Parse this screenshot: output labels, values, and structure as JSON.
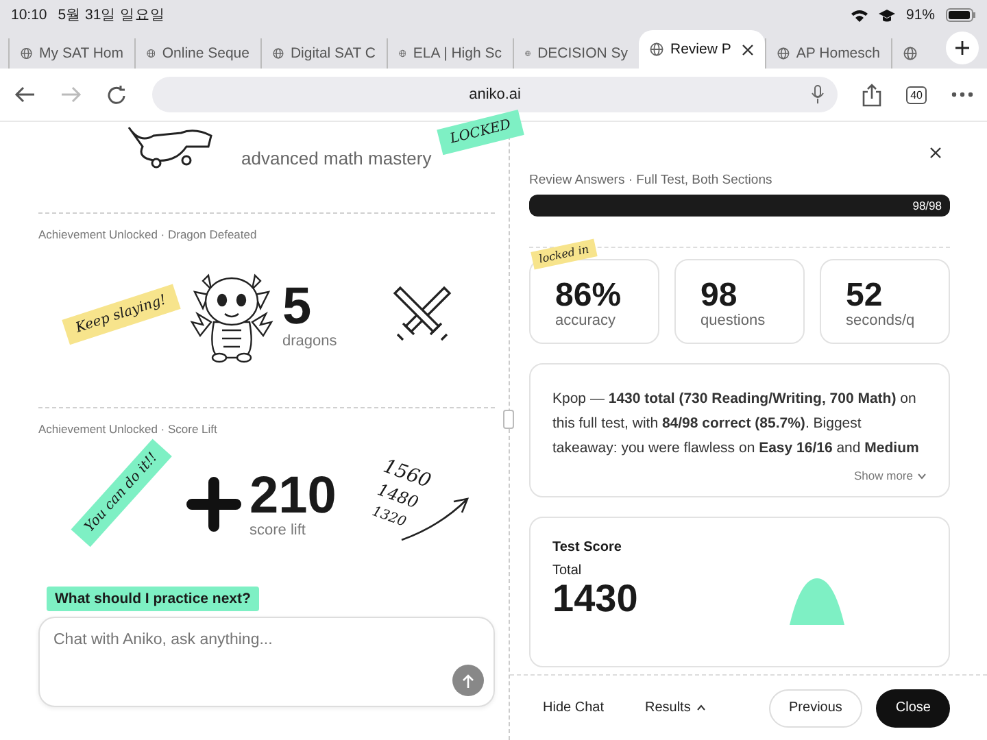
{
  "status_bar": {
    "time": "10:10",
    "date": "5월 31일 일요일",
    "battery": "91%"
  },
  "tabs": [
    {
      "label": "My SAT Hom",
      "selected": false
    },
    {
      "label": "Online Seque",
      "selected": false
    },
    {
      "label": "Digital SAT C",
      "selected": false
    },
    {
      "label": "ELA | High Sc",
      "selected": false
    },
    {
      "label": "DECISION Sy",
      "selected": false
    },
    {
      "label": "Review P",
      "selected": true
    },
    {
      "label": "AP Homesch",
      "selected": false
    }
  ],
  "toolbar": {
    "url": "aniko.ai",
    "tab_count": "40",
    "forward_disabled": true
  },
  "sections": [
    {
      "kind": "mastery",
      "caption": "advanced math mastery",
      "sticker": {
        "text": "LOCKED",
        "color": "#7ef0c4"
      }
    },
    {
      "kind": "dragons",
      "label": "Achievement Unlocked · Dragon Defeated",
      "sticker": {
        "text": "Keep slaying!",
        "color": "#f7e48c"
      },
      "value": "5",
      "unit": "dragons"
    },
    {
      "kind": "score_lift",
      "label": "Achievement Unlocked · Score Lift",
      "sticker": {
        "text": "You can do it!!",
        "color": "#7ef0c4"
      },
      "value": "210",
      "unit": "score lift",
      "notes": [
        "1560",
        "1480",
        "1320"
      ]
    }
  ],
  "prompt_chip": "What should I practice next?",
  "chat": {
    "placeholder": "Chat with Aniko, ask anything..."
  },
  "review": {
    "title": "Review Answers · Full Test, Both Sections",
    "progress": {
      "level": 1,
      "reading": "98/98"
    },
    "stamp": "locked in",
    "stats": [
      {
        "value": "86%",
        "label": "accuracy"
      },
      {
        "value": "98",
        "label": "questions"
      },
      {
        "value": "52",
        "label": "seconds/q"
      }
    ],
    "summary": "Kpop — **1430 total (730 Reading/Writing, 700 Math)** on this full test, with **84/98 correct (85.7%)**. Biggest takeaway: you were flawless on **Easy 16/16** and **Medium**",
    "show_more": "Show more",
    "score_card": {
      "title": "Test Score",
      "label": "Total",
      "value": "1430"
    }
  },
  "footer": {
    "hide_chat": "Hide Chat",
    "results": "Results",
    "previous": "Previous",
    "close": "Close"
  }
}
